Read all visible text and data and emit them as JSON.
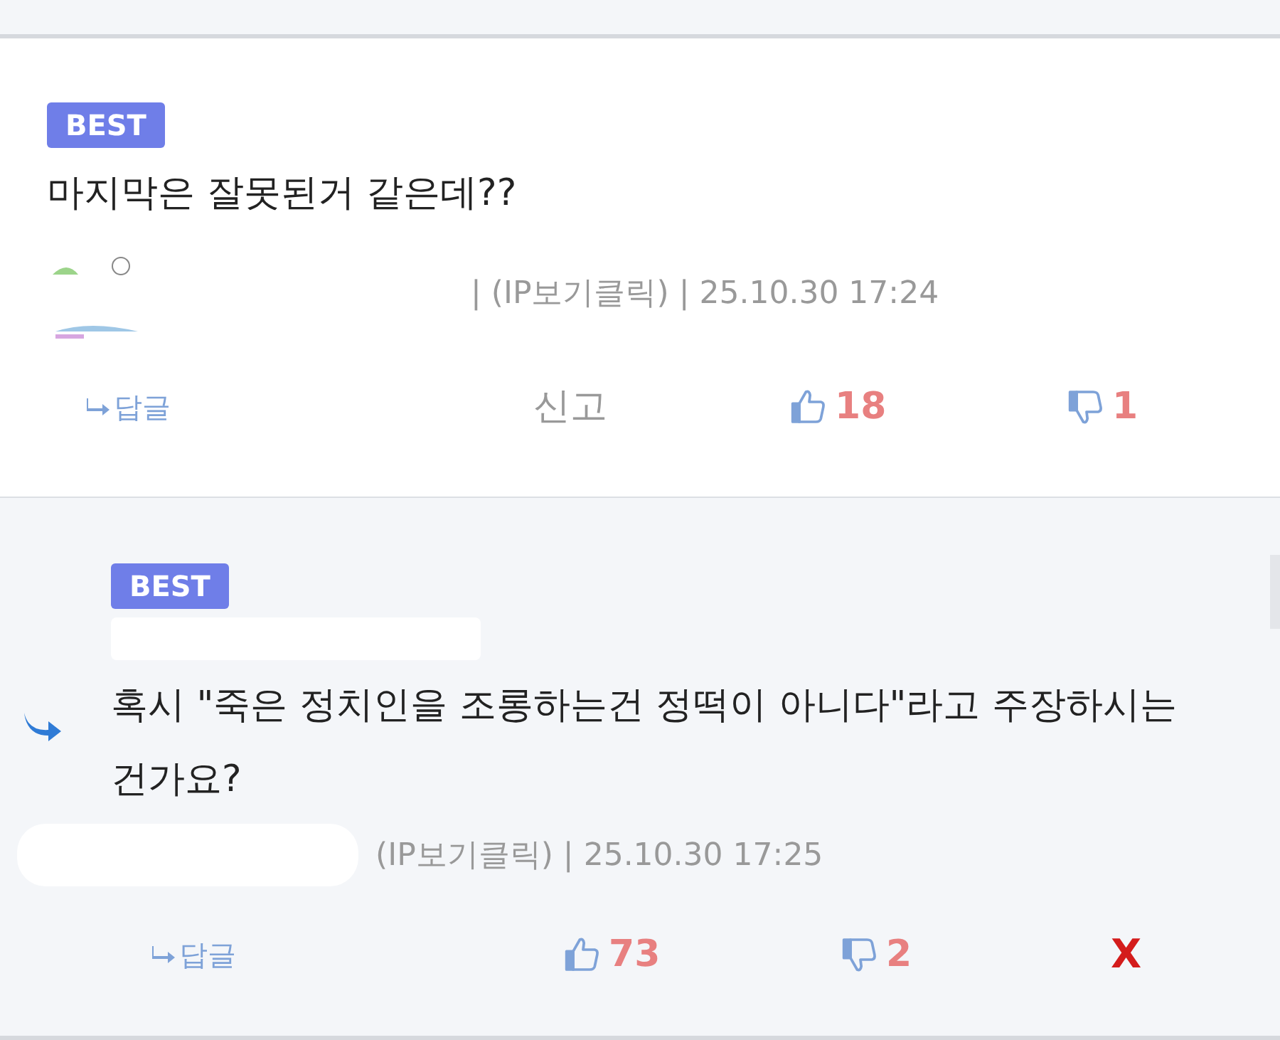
{
  "comments": [
    {
      "kind": "comment",
      "badge": "BEST",
      "text": "마지막은 잘못된거 같은데??",
      "meta": "| (IP보기클릭) | 25.10.30 17:24",
      "reply_label": "답글",
      "report": "신고",
      "likes": "18",
      "dislikes": "1"
    },
    {
      "kind": "reply",
      "badge": "BEST",
      "text": "혹시 \"죽은 정치인을 조롱하는건 정떡이 아니다\"라고 주장하시는건가요?",
      "meta": "(IP보기클릭) | 25.10.30 17:25",
      "reply_label": "답글",
      "likes": "73",
      "dislikes": "2",
      "delete": "X"
    }
  ]
}
